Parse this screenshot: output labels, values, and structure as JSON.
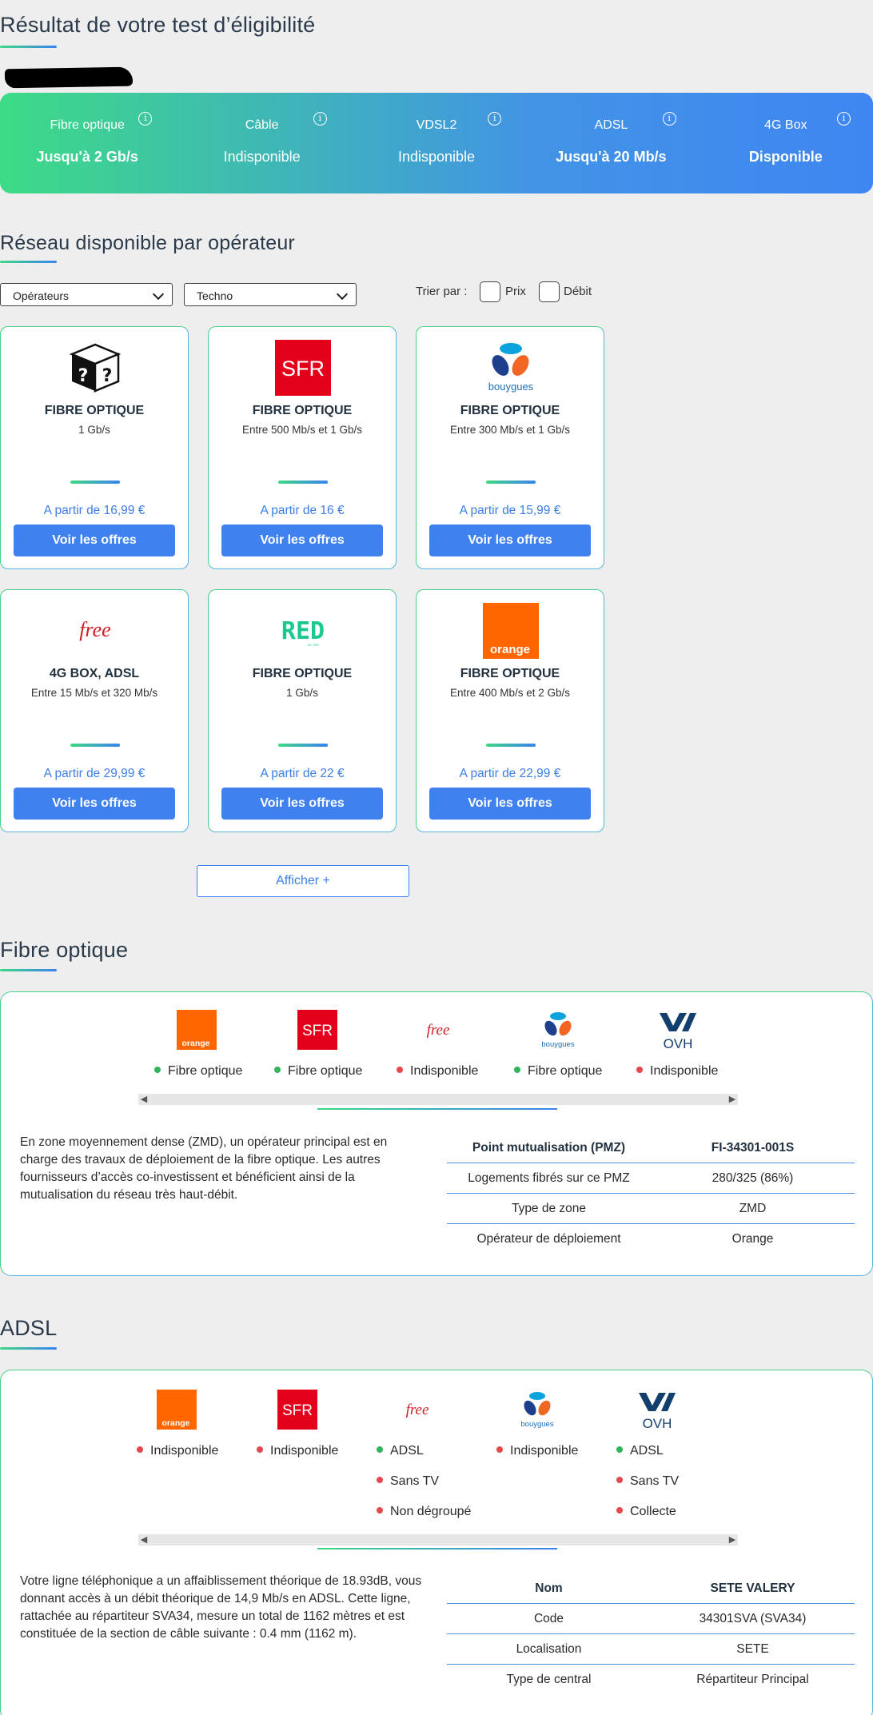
{
  "headings": {
    "result": "Résultat de votre test d’éligibilité",
    "network": "Réseau disponible par opérateur",
    "fibre": "Fibre optique",
    "adsl": "ADSL"
  },
  "banner": [
    {
      "name": "Fibre optique",
      "value": "Jusqu'à 2 Gb/s",
      "bold": true
    },
    {
      "name": "Câble",
      "value": "Indisponible",
      "bold": false
    },
    {
      "name": "VDSL2",
      "value": "Indisponible",
      "bold": false
    },
    {
      "name": "ADSL",
      "value": "Jusqu'à 20 Mb/s",
      "bold": true
    },
    {
      "name": "4G Box",
      "value": "Disponible",
      "bold": true
    }
  ],
  "info_glyph": "i",
  "filters": {
    "operators": "Opérateurs",
    "techno": "Techno",
    "sort_label": "Trier par :",
    "price": "Prix",
    "speed": "Débit"
  },
  "cards": [
    {
      "logo": "unknown-box",
      "tech": "FIBRE OPTIQUE",
      "speed": "1 Gb/s",
      "price": "A partir de 16,99 €",
      "button": "Voir les offres"
    },
    {
      "logo": "sfr",
      "tech": "FIBRE OPTIQUE",
      "speed": "Entre 500 Mb/s et 1 Gb/s",
      "price": "A partir de 16 €",
      "button": "Voir les offres"
    },
    {
      "logo": "bouygues",
      "tech": "FIBRE OPTIQUE",
      "speed": "Entre 300 Mb/s et 1 Gb/s",
      "price": "A partir de 15,99 €",
      "button": "Voir les offres"
    },
    {
      "logo": "free",
      "tech": "4G BOX, ADSL",
      "speed": "Entre 15 Mb/s et 320 Mb/s",
      "price": "A partir de 29,99 €",
      "button": "Voir les offres"
    },
    {
      "logo": "red",
      "tech": "FIBRE OPTIQUE",
      "speed": "1 Gb/s",
      "price": "A partir de 22 €",
      "button": "Voir les offres"
    },
    {
      "logo": "orange",
      "tech": "FIBRE OPTIQUE",
      "speed": "Entre 400 Mb/s et 2 Gb/s",
      "price": "A partir de 22,99 €",
      "button": "Voir les offres"
    }
  ],
  "more_button": "Afficher +",
  "logo_text": {
    "sfr": "SFR",
    "free": "free",
    "red": "RED",
    "red_sub": "BY SFR",
    "orange": "orange",
    "bouygues": "bouygues",
    "ovh": "OVH",
    "question": "?"
  },
  "fibre": {
    "operators": [
      {
        "logo": "orange",
        "status": [
          {
            "text": "Fibre optique",
            "ok": true
          }
        ]
      },
      {
        "logo": "sfr",
        "status": [
          {
            "text": "Fibre optique",
            "ok": true
          }
        ]
      },
      {
        "logo": "free",
        "status": [
          {
            "text": "Indisponible",
            "ok": false
          }
        ]
      },
      {
        "logo": "bouygues",
        "status": [
          {
            "text": "Fibre optique",
            "ok": true
          }
        ]
      },
      {
        "logo": "ovh",
        "status": [
          {
            "text": "Indisponible",
            "ok": false
          }
        ]
      }
    ],
    "text": "En zone moyennement dense (ZMD), un opérateur principal est en charge des travaux de déploiement de la fibre optique. Les autres fournisseurs d’accès co-investissent et bénéficient ainsi de la mutualisation du réseau très haut-débit.",
    "table": [
      [
        "Point mutualisation (PMZ)",
        "FI-34301-001S"
      ],
      [
        "Logements fibrés sur ce PMZ",
        "280/325 (86%)"
      ],
      [
        "Type de zone",
        "ZMD"
      ],
      [
        "Opérateur de déploiement",
        "Orange"
      ]
    ]
  },
  "adsl": {
    "operators": [
      {
        "logo": "orange",
        "status": [
          {
            "text": "Indisponible",
            "ok": false
          }
        ]
      },
      {
        "logo": "sfr",
        "status": [
          {
            "text": "Indisponible",
            "ok": false
          }
        ]
      },
      {
        "logo": "free",
        "status": [
          {
            "text": "ADSL",
            "ok": true
          },
          {
            "text": "Sans TV",
            "ok": false
          },
          {
            "text": "Non dégroupé",
            "ok": false
          }
        ]
      },
      {
        "logo": "bouygues",
        "status": [
          {
            "text": "Indisponible",
            "ok": false
          }
        ]
      },
      {
        "logo": "ovh",
        "status": [
          {
            "text": "ADSL",
            "ok": true
          },
          {
            "text": "Sans TV",
            "ok": false
          },
          {
            "text": "Collecte",
            "ok": false
          }
        ]
      }
    ],
    "text": "Votre ligne téléphonique a un affaiblissement théorique de 18.93dB, vous donnant accès à un débit théorique de 14,9 Mb/s en ADSL. Cette ligne, rattachée au répartiteur SVA34, mesure un total de 1162 mètres et est constituée de la section de câble suivante : 0.4 mm (1162 m).",
    "table": [
      [
        "Nom",
        "SETE VALERY"
      ],
      [
        "Code",
        "34301SVA (SVA34)"
      ],
      [
        "Localisation",
        "SETE"
      ],
      [
        "Type de central",
        "Répartiteur Principal"
      ]
    ]
  }
}
